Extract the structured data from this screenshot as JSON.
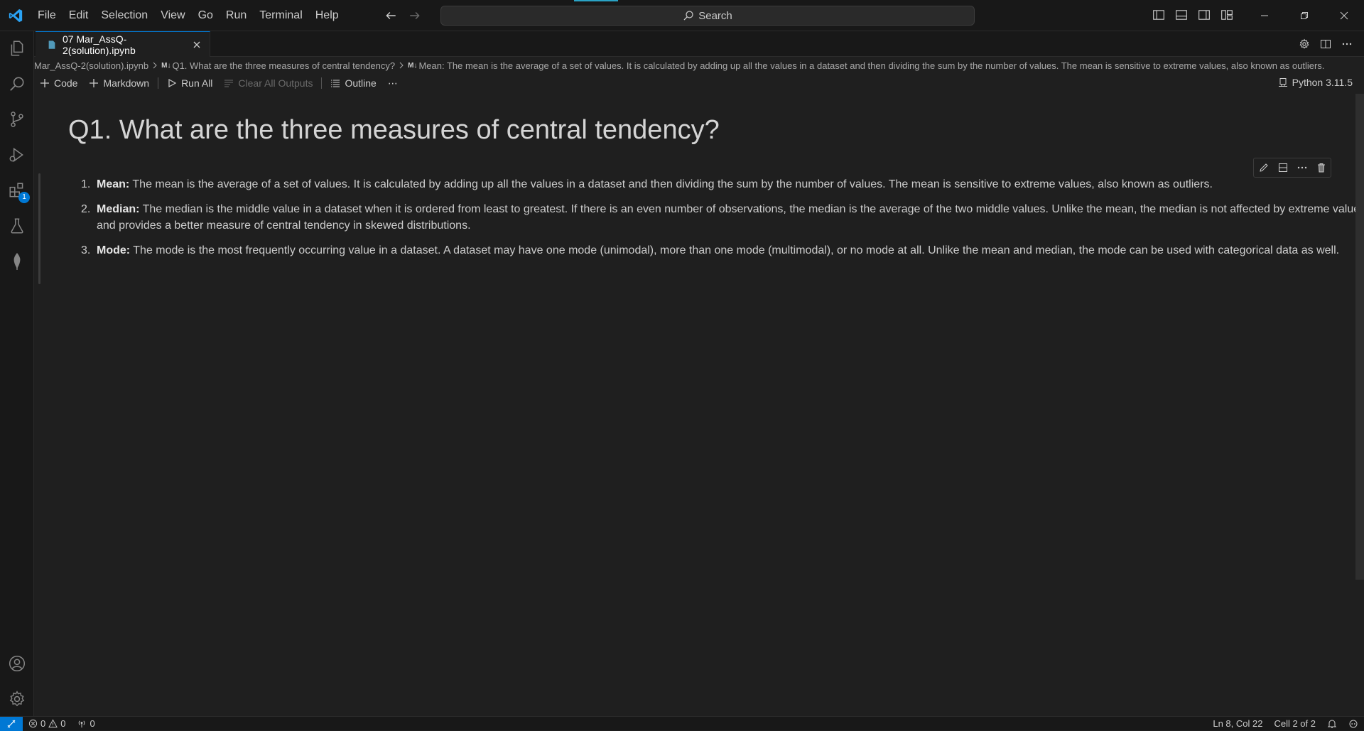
{
  "menu": [
    "File",
    "Edit",
    "Selection",
    "View",
    "Go",
    "Run",
    "Terminal",
    "Help"
  ],
  "search": {
    "label": "Search"
  },
  "tab": {
    "title": "07 Mar_AssQ-2(solution).ipynb"
  },
  "breadcrumb": {
    "file": "Mar_AssQ-2(solution).ipynb",
    "md_badge": "M↓",
    "heading": "Q1. What are the three measures of central tendency?",
    "item": "Mean: The mean is the average of a set of values. It is calculated by adding up all the values in a dataset and then dividing the sum by the number of values. The mean is sensitive to extreme values, also known as outliers."
  },
  "toolbar": {
    "code": "Code",
    "markdown": "Markdown",
    "run_all": "Run All",
    "clear_outputs": "Clear All Outputs",
    "outline": "Outline",
    "more": "⋯",
    "kernel": "Python 3.11.5"
  },
  "cell": {
    "heading": "Q1. What are the three measures of central tendency?",
    "items": [
      {
        "num": "1.",
        "term": "Mean:",
        "text": " The mean is the average of a set of values. It is calculated by adding up all the values in a dataset and then dividing the sum by the number of values. The mean is sensitive to extreme values, also known as outliers."
      },
      {
        "num": "2.",
        "term": "Median:",
        "text": " The median is the middle value in a dataset when it is ordered from least to greatest. If there is an even number of observations, the median is the average of the two middle values. Unlike the mean, the median is not affected by extreme values and provides a better measure of central tendency in skewed distributions."
      },
      {
        "num": "3.",
        "term": "Mode:",
        "text": " The mode is the most frequently occurring value in a dataset. A dataset may have one mode (unimodal), more than one mode (multimodal), or no mode at all. Unlike the mean and median, the mode can be used with categorical data as well."
      }
    ]
  },
  "activity": {
    "extensions_badge": "1"
  },
  "status": {
    "errors": "0",
    "warnings": "0",
    "ports": "0",
    "position": "Ln 8, Col 22",
    "cell": "Cell 2 of 2"
  },
  "colors": {
    "accent": "#0078d4",
    "background": "#1f1f1f",
    "bar": "#181818"
  }
}
